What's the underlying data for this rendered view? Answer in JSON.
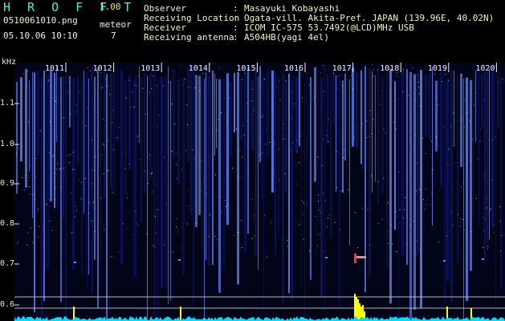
{
  "header": {
    "brand": "H R O F F T",
    "version": "1.00",
    "filename": "0510061010.png",
    "datetime": "05.10.06 10:10",
    "meteor_label": "meteor",
    "meteor_count": "7"
  },
  "info": [
    {
      "label": "Observer",
      "value": "Masayuki Kobayashi"
    },
    {
      "label": "Receiving Location",
      "value": "Ogata-vill. Akita-Pref. JAPAN (139.96E, 40.02N)"
    },
    {
      "label": "Receiver",
      "value": "ICOM IC-575 53.7492(@LCD)MHz USB"
    },
    {
      "label": "Receiving antenna",
      "value": "A504HB(yagi 4el)"
    }
  ],
  "spectrogram": {
    "unit_label": "kHz",
    "y_ticks": [
      "1.1",
      "1.0",
      "0.9",
      "0.8",
      "0.7",
      "0.6"
    ],
    "x_ticks": [
      "1011",
      "1012",
      "1013",
      "1014",
      "1015",
      "1016",
      "1017",
      "1018",
      "1019",
      "1020"
    ],
    "colors": {
      "noise_low": "#0d1d8a",
      "noise_high": "#5f88ff",
      "signal": "#ff3040",
      "peak": "#ffff00",
      "baseline": "#00dcff"
    }
  }
}
